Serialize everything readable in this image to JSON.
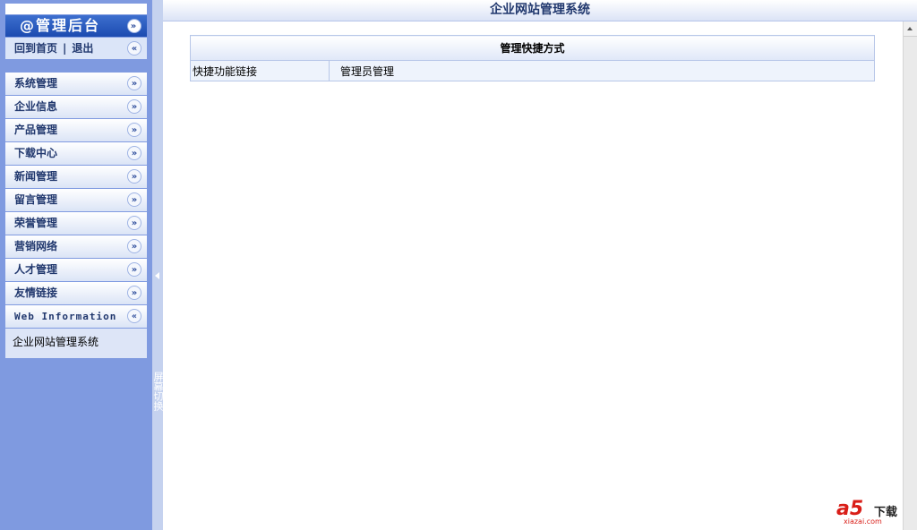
{
  "sidebar": {
    "brand": "@管理后台",
    "home_link": "回到首页",
    "separator": "|",
    "logout_link": "退出",
    "menu": [
      {
        "label": "系统管理"
      },
      {
        "label": "企业信息"
      },
      {
        "label": "产品管理"
      },
      {
        "label": "下载中心"
      },
      {
        "label": "新闻管理"
      },
      {
        "label": "留言管理"
      },
      {
        "label": "荣誉管理"
      },
      {
        "label": "营销网络"
      },
      {
        "label": "人才管理"
      },
      {
        "label": "友情链接"
      }
    ],
    "web_info_title": "Web Information",
    "web_info_text": "企业网站管理系统"
  },
  "splitter": {
    "label": "屏幕切换"
  },
  "header": {
    "title": "企业网站管理系统"
  },
  "main": {
    "table_title": "管理快捷方式",
    "row_label": "快捷功能链接",
    "row_link": "管理员管理"
  },
  "watermark": {
    "logo": "a5",
    "text": "下载",
    "sub": "xiazai.com"
  },
  "colors": {
    "sidebar_bg": "#7f9ae0",
    "brand_bg": "#1c4bb0",
    "text_dark": "#21386e",
    "splitter_bg": "#c5d2ef"
  }
}
